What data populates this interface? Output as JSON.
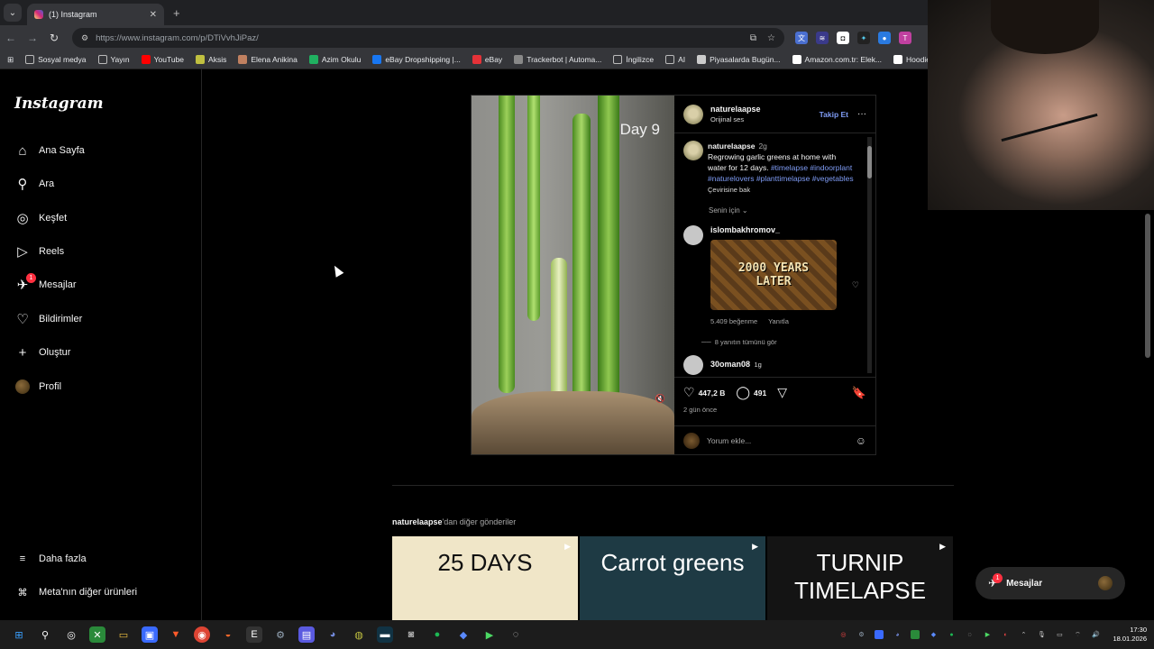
{
  "browser": {
    "tab_title": "(1) Instagram",
    "new_tab": "+",
    "url": "https://www.instagram.com/p/DTiVvhJiPaz/",
    "bookmarks": [
      {
        "label": "Sosyal medya",
        "icon": "folder-icon",
        "color": "#bbbbbb"
      },
      {
        "label": "Yayın",
        "icon": "folder-icon",
        "color": "#bbbbbb"
      },
      {
        "label": "YouTube",
        "icon": "youtube-icon",
        "color": "#ff0000"
      },
      {
        "label": "Aksis",
        "icon": "aksis-icon",
        "color": "#c0c040"
      },
      {
        "label": "Elena Anikina",
        "icon": "elena-icon",
        "color": "#c08060"
      },
      {
        "label": "Azim Okulu",
        "icon": "azim-icon",
        "color": "#20b060"
      },
      {
        "label": "eBay Dropshipping |...",
        "icon": "facebook-icon",
        "color": "#1877f2"
      },
      {
        "label": "eBay",
        "icon": "ebay-icon",
        "color": "#e53238"
      },
      {
        "label": "Trackerbot | Automa...",
        "icon": "trackerbot-icon",
        "color": "#888888"
      },
      {
        "label": "İngilizce",
        "icon": "folder-icon",
        "color": "#bbbbbb"
      },
      {
        "label": "AI",
        "icon": "folder-icon",
        "color": "#bbbbbb"
      },
      {
        "label": "Piyasalarda Bugün...",
        "icon": "tradingview-icon",
        "color": "#cccccc"
      },
      {
        "label": "Amazon.com.tr: Elek...",
        "icon": "amazon-icon",
        "color": "#ffffff"
      },
      {
        "label": "Hoodie Modelleri |",
        "icon": "hoodie-icon",
        "color": "#ffffff"
      }
    ]
  },
  "instagram": {
    "logo": "Instagram",
    "nav": [
      {
        "label": "Ana Sayfa",
        "icon": "home-icon",
        "glyph": "⌂"
      },
      {
        "label": "Ara",
        "icon": "search-icon",
        "glyph": "⚲"
      },
      {
        "label": "Keşfet",
        "icon": "compass-icon",
        "glyph": "◎"
      },
      {
        "label": "Reels",
        "icon": "reels-icon",
        "glyph": "▷"
      },
      {
        "label": "Mesajlar",
        "icon": "messenger-icon",
        "glyph": "✈",
        "badge": "1"
      },
      {
        "label": "Bildirimler",
        "icon": "heart-icon",
        "glyph": "♡"
      },
      {
        "label": "Oluştur",
        "icon": "plus-icon",
        "glyph": "+"
      },
      {
        "label": "Profil",
        "icon": "avatar",
        "glyph": ""
      }
    ],
    "more": {
      "label": "Daha fazla",
      "glyph": "≡"
    },
    "meta": {
      "label": "Meta'nın diğer ürünleri",
      "glyph": "⌘"
    },
    "post": {
      "media_text": "Day 9",
      "author": "naturelaapse",
      "audio": "Orijinal ses",
      "follow": "Takip Et",
      "options": "···",
      "caption": {
        "user": "naturelaapse",
        "time": "2g",
        "text": "Regrowing garlic greens at home with water for 12 days.",
        "tags": "#timelapse #indoorplant #naturelovers #planttimelapse #vegetables",
        "see_translation": "Çevirisine bak"
      },
      "filter": "Senin için",
      "comments": [
        {
          "user": "islombakhromov_",
          "gif_line1": "2000 YEARS",
          "gif_line2": "LATER",
          "likes": "5.409 beğenme",
          "reply": "Yanıtla",
          "view_replies": "8 yanıtın tümünü gör"
        },
        {
          "user": "30oman08",
          "time": "1g"
        }
      ],
      "likes": "447,2 B",
      "comment_count": "491",
      "posted": "2 gün önce",
      "comment_placeholder": "Yorum ekle..."
    },
    "more_posts": {
      "user": "naturelaapse",
      "suffix": "'dan diğer gönderiler",
      "thumbs": [
        {
          "text": "25 DAYS",
          "bg": "#f0e6c8",
          "fg": "#111111"
        },
        {
          "text": "Carrot greens",
          "bg": "#1e3a44",
          "fg": "#ffffff"
        },
        {
          "text": "TURNIP TIMELAPSE",
          "bg": "#141414",
          "fg": "#ffffff"
        }
      ]
    },
    "messages_pill": {
      "label": "Mesajlar",
      "badge": "1"
    }
  },
  "taskbar": {
    "time": "17:30",
    "date": "18.01.2026"
  }
}
